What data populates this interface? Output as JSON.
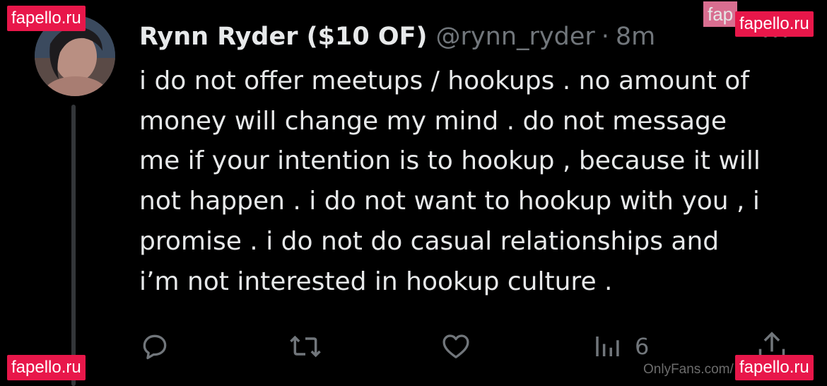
{
  "tweet": {
    "display_name": "Rynn Ryder ($10 OF)",
    "handle": "@rynn_ryder",
    "separator": "·",
    "time": "8m",
    "text": "i do not offer meetups / hookups . no amount of\nmoney will change my mind . do not message\nme if your intention is to hookup , because it will\nnot happen . i do not want to hookup with you , i\npromise . i do not do casual relationships and\ni’m not interested in hookup culture ."
  },
  "actions": {
    "reply_icon": "reply-icon",
    "retweet_icon": "retweet-icon",
    "like_icon": "heart-icon",
    "views_icon": "views-icon",
    "views_count": "6",
    "share_icon": "share-icon"
  },
  "watermarks": {
    "top_left": "fapello.ru",
    "top_right": "fapello.ru",
    "top_right_ghost": "fap",
    "bottom_left": "fapello.ru",
    "bottom_right": "fapello.ru",
    "onlyfans": "OnlyFans.com/"
  },
  "colors": {
    "background": "#000000",
    "primary_text": "#e7e9ea",
    "secondary_text": "#71767b",
    "thread_line": "#333639",
    "watermark": "#e8174a"
  }
}
